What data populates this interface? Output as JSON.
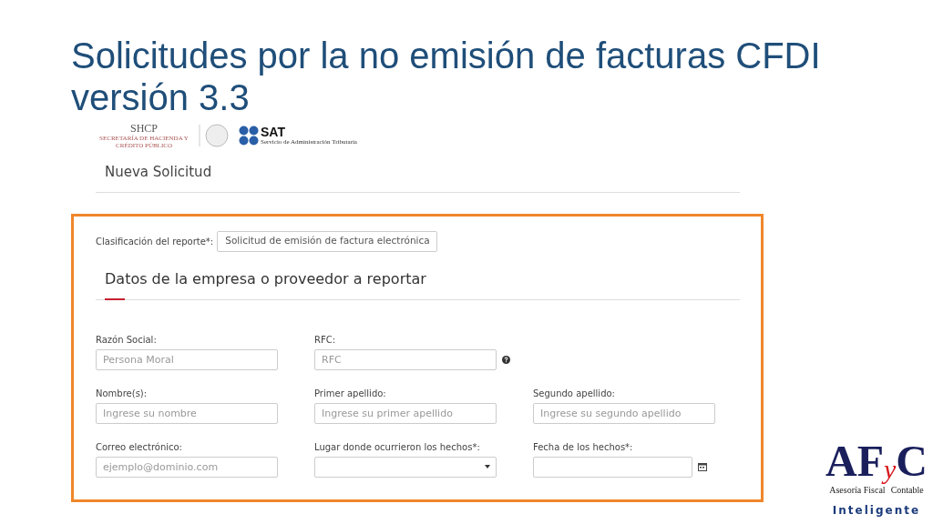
{
  "slide_title": "Solicitudes por la no emisión de facturas CFDI versión 3.3",
  "header_logos": {
    "shcp": "SHCP",
    "shcp_subtitle": "SECRETARÍA DE HACIENDA Y CRÉDITO PÚBLICO",
    "sat": "SAT",
    "sat_subtitle": "Servicio de Administración Tributaria"
  },
  "page_heading": "Nueva Solicitud",
  "classification": {
    "label": "Clasificación del reporte*:",
    "value": "Solicitud de emisión de factura electrónica"
  },
  "section_heading": "Datos de la empresa o proveedor a reportar",
  "fields": [
    {
      "kind": "text",
      "label": "Razón Social:",
      "placeholder": "Persona Moral"
    },
    {
      "kind": "text",
      "label": "RFC:",
      "placeholder": "RFC",
      "help": true
    },
    {
      "kind": "empty"
    },
    {
      "kind": "text",
      "label": "Nombre(s):",
      "placeholder": "Ingrese su nombre"
    },
    {
      "kind": "text",
      "label": "Primer apellido:",
      "placeholder": "Ingrese su primer apellido"
    },
    {
      "kind": "text",
      "label": "Segundo apellido:",
      "placeholder": "Ingrese su segundo apellido"
    },
    {
      "kind": "text",
      "label": "Correo electrónico:",
      "placeholder": "ejemplo@dominio.com"
    },
    {
      "kind": "select",
      "label": "Lugar donde ocurrieron los hechos*:"
    },
    {
      "kind": "date",
      "label": "Fecha de los hechos*:"
    }
  ],
  "brand_logo": {
    "letters": "AF",
    "small_letter": "y",
    "last_letter": "C",
    "left_text": "Asesoría Fiscal",
    "right_text": "Contable",
    "tagline": "Inteligente"
  }
}
